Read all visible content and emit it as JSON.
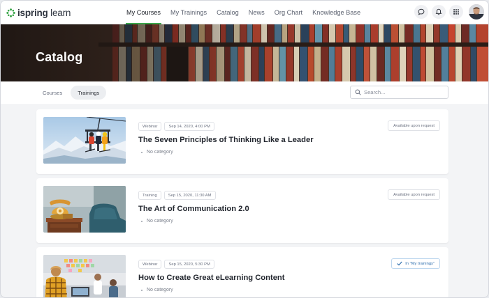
{
  "app": {
    "logo_brand": "ispring",
    "logo_product": "learn"
  },
  "nav": {
    "items": [
      {
        "label": "My Courses",
        "active": true
      },
      {
        "label": "My Trainings",
        "active": false
      },
      {
        "label": "Catalog",
        "active": false
      },
      {
        "label": "News",
        "active": false
      },
      {
        "label": "Org Chart",
        "active": false
      },
      {
        "label": "Knowledge Base",
        "active": false
      }
    ],
    "icons": [
      "chat-icon",
      "bell-icon",
      "apps-grid-icon"
    ]
  },
  "page": {
    "title": "Catalog"
  },
  "tabs": [
    {
      "label": "Courses",
      "active": false
    },
    {
      "label": "Trainings",
      "active": true
    }
  ],
  "search": {
    "placeholder": "Search...",
    "value": ""
  },
  "trainings": [
    {
      "type": "Webinar",
      "date": "Sep 14, 2020, 4:00 PM",
      "title": "The Seven Principles of Thinking Like a Leader",
      "category": "No category",
      "status": "Available upon request",
      "image": "ski-lift-photo"
    },
    {
      "type": "Training",
      "date": "Sep 15, 2020, 11:30 AM",
      "title": "The Art of Communication 2.0",
      "category": "No category",
      "status": "Available upon request",
      "image": "vintage-phone-photo"
    },
    {
      "type": "Webinar",
      "date": "Sep 15, 2020, 5:30 PM",
      "title": "How to Create Great eLearning Content",
      "category": "No category",
      "status": "In \"My trainings\"",
      "image": "office-team-photo"
    }
  ],
  "colors": {
    "accent": "#3aa54a",
    "added": "#2f6fae"
  }
}
